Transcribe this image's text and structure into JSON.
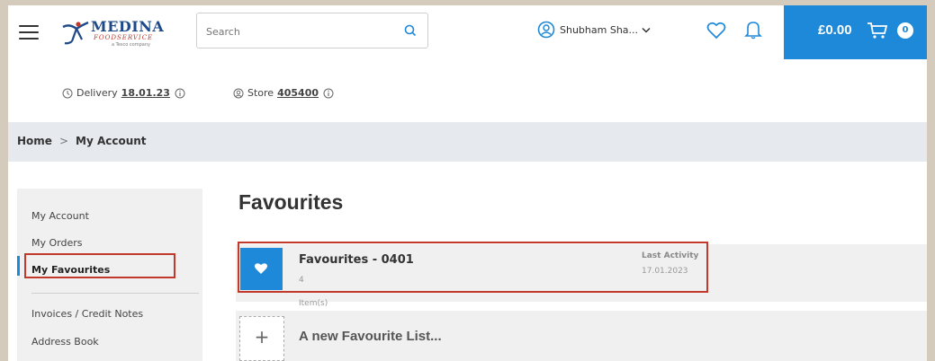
{
  "header": {
    "logo": {
      "brand": "MEDINA",
      "sub": "FOODSERVICE",
      "tagline": "a Tesco company"
    },
    "search": {
      "placeholder": "Search"
    },
    "user": {
      "name": "Shubham Sha..."
    },
    "basket": {
      "total": "£0.00",
      "count": "0"
    }
  },
  "info": {
    "delivery_label": "Delivery",
    "delivery_date": "18.01.23",
    "store_label": "Store",
    "store_number": "405400"
  },
  "breadcrumb": {
    "home": "Home",
    "separator": ">",
    "current": "My Account"
  },
  "sidebar": {
    "items": [
      {
        "label": "My Account"
      },
      {
        "label": "My Orders"
      },
      {
        "label": "My Favourites"
      },
      {
        "label": "Invoices / Credit Notes"
      },
      {
        "label": "Address Book"
      }
    ]
  },
  "main": {
    "title": "Favourites",
    "list": {
      "name": "Favourites - 0401",
      "count": "4",
      "items_label": "Item(s)",
      "last_activity_label": "Last Activity",
      "last_activity_date": "17.01.2023"
    },
    "new_list_label": "A new Favourite List..."
  },
  "colors": {
    "accent": "#1e88d9",
    "highlight": "#c0392b",
    "page_bg": "#d4cbbd"
  },
  "icons": [
    "menu-icon",
    "search-icon",
    "user-icon",
    "chevron-down-icon",
    "heart-icon",
    "bell-icon",
    "cart-icon",
    "clock-icon",
    "info-icon",
    "store-icon",
    "plus-icon"
  ]
}
